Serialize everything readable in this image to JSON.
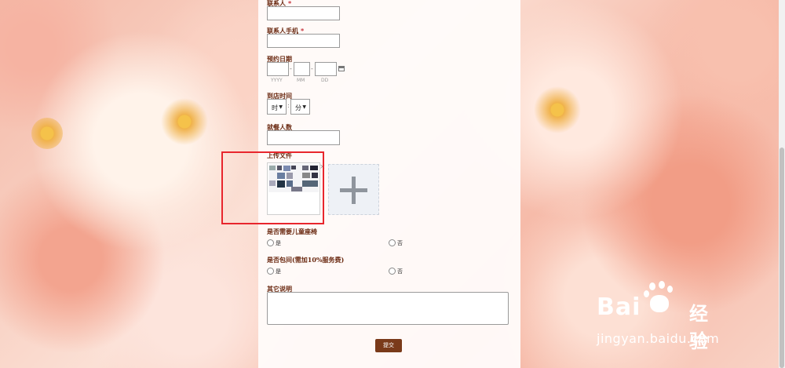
{
  "form": {
    "contact_label": "联系人",
    "required_mark": "*",
    "phone_label": "联系人手机",
    "date_label": "预约日期",
    "date_year_hint": "YYYY",
    "date_month_hint": "MM",
    "date_day_hint": "DD",
    "date_sep": "-",
    "time_label": "到店时间",
    "hour_select": "时",
    "minute_select": "分",
    "time_sep": ":",
    "diners_label": "就餐人数",
    "upload_label": "上传文件",
    "child_seat_label": "是否需要儿童座椅",
    "private_room_label": "是否包间(需加10%服务费)",
    "option_yes": "是",
    "option_no": "否",
    "notes_label": "其它说明",
    "submit_label": "提交",
    "remove_file": "×",
    "add_file": "+"
  },
  "watermark": {
    "brand_prefix": "Bai",
    "brand_suffix": "经验",
    "url": "jingyan.baidu.com"
  }
}
